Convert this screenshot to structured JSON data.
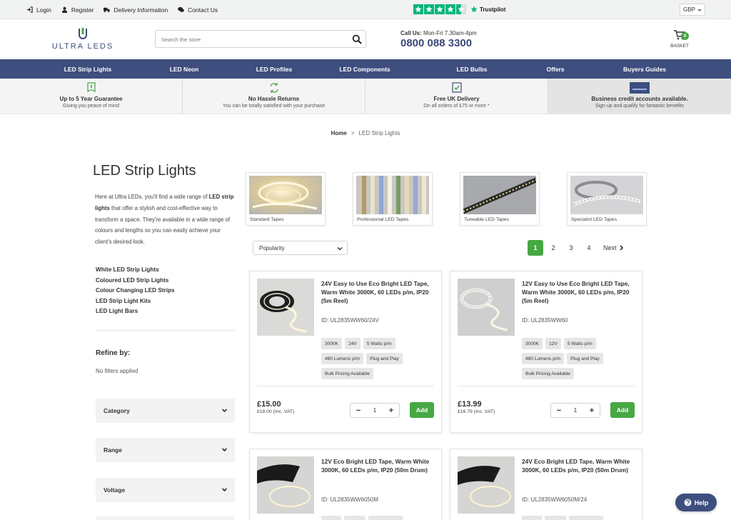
{
  "topbar": {
    "links": [
      {
        "label": "Login",
        "icon": "login-icon"
      },
      {
        "label": "Register",
        "icon": "user-icon"
      },
      {
        "label": "Delivery Information",
        "icon": "truck-icon"
      },
      {
        "label": "Contact Us",
        "icon": "chat-icon"
      }
    ],
    "trustpilot_label": "Trustpilot",
    "trustpilot_stars": 4.5,
    "currency": "GBP"
  },
  "header": {
    "logo_text": "ULTRA LEDS",
    "search_placeholder": "Search the store",
    "callus_label": "Call Us:",
    "callus_hours": "Mon-Fri 7.30am-4pm",
    "phone": "0800 088 3300",
    "basket_count": "0",
    "basket_label": "BASKET"
  },
  "nav": {
    "items": [
      "LED Strip Lights",
      "LED Neon",
      "LED Profiles",
      "LED Components",
      "LED Bulbs",
      "Offers",
      "Buyers Guides"
    ]
  },
  "usp": [
    {
      "title": "Up to 5 Year Guarantee",
      "sub": "Giving you peace of mind"
    },
    {
      "title": "No Hassle Returns",
      "sub": "You can be totally satisfied with your purchase"
    },
    {
      "title": "Free UK Delivery",
      "sub": "On all orders of £75 or more *"
    },
    {
      "title": "Business credit accounts available.",
      "sub": "Sign up and qualify for fantastic benefits"
    }
  ],
  "breadcrumb": {
    "home": "Home",
    "sep": ">",
    "current": "LED Strip Lights"
  },
  "sidebar": {
    "title": "LED Strip Lights",
    "intro_1": "Here at Ultra LEDs, you'll find a wide range of ",
    "intro_bold": "LED strip lights",
    "intro_2": " that offer a stylish and cost-effective way to transform a space. They're available in a wide range of colours and lengths so you can easily achieve your client's desired look.",
    "links": [
      "White LED Strip Lights",
      "Coloured LED Strip Lights",
      "Colour Changing LED Strips",
      "LED Strip Light Kits",
      "LED Light Bars"
    ],
    "refine_title": "Refine by:",
    "refine_none": "No filters applied",
    "filters": [
      "Category",
      "Range",
      "Voltage"
    ]
  },
  "categories": [
    {
      "label": "Standard Tapes"
    },
    {
      "label": "Professional LED Tapes"
    },
    {
      "label": "Tuneable LED Tapes"
    },
    {
      "label": "Specialist LED Tapes"
    }
  ],
  "sort": {
    "value": "Popularity"
  },
  "pagination": {
    "pages": [
      "1",
      "2",
      "3",
      "4"
    ],
    "active": "1",
    "next": "Next"
  },
  "products": [
    {
      "title": "24V Easy to Use Eco Bright LED Tape, Warm White 3000K, 60 LEDs p/m, IP20 (5m Reel)",
      "id": "ID: UL2835WW60/24V",
      "tags": [
        "3000K",
        "24V",
        "5 Watts p/m",
        "480 Lumens p/m",
        "Plug and Play",
        "Bulk Pricing Available"
      ],
      "price": "£15.00",
      "price_vat": "£18.00 (Inc. VAT)",
      "qty": "1",
      "add_label": "Add"
    },
    {
      "title": "12V Easy to Use Eco Bright LED Tape, Warm White 3000K, 60 LEDs p/m, IP20 (5m Reel)",
      "id": "ID: UL2835WW60",
      "tags": [
        "3000K",
        "12V",
        "5 Watts p/m",
        "480 Lumens p/m",
        "Plug and Play",
        "Bulk Pricing Available"
      ],
      "price": "£13.99",
      "price_vat": "£16.79 (Inc. VAT)",
      "qty": "1",
      "add_label": "Add"
    },
    {
      "title": "12V Eco Bright LED Tape, Warm White 3000K, 60 LEDs p/m, IP20 (50m Drum)",
      "id": "ID: UL2835WW6050M"
    },
    {
      "title": "24V Eco Bright LED Tape, Warm White 3000K, 60 LEDs p/m, IP20 (50m Drum)",
      "id": "ID: UL2835WW6050M/24"
    }
  ],
  "help_label": "Help",
  "colors": {
    "brand_navy": "#3e4e7f",
    "accent_green": "#46a843",
    "trustpilot_green": "#00b67a"
  }
}
